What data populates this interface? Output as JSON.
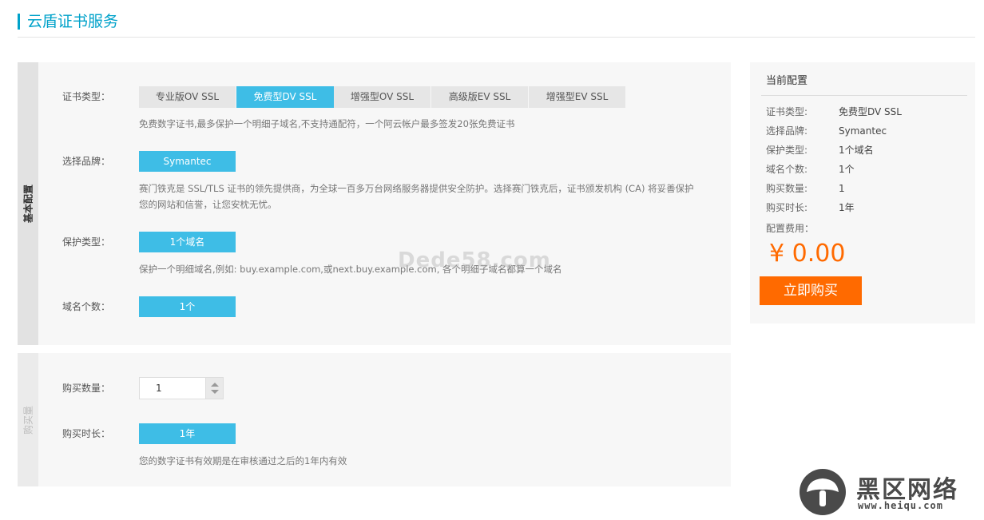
{
  "header": {
    "title": "云盾证书服务"
  },
  "basic": {
    "side_label": "基本配置",
    "cert_type": {
      "label": "证书类型：",
      "options": [
        "专业版OV SSL",
        "免费型DV SSL",
        "增强型OV SSL",
        "高级版EV SSL",
        "增强型EV SSL"
      ],
      "selected": "免费型DV SSL",
      "hint": "免费数字证书,最多保护一个明细子域名,不支持通配符，一个阿云帐户最多签发20张免费证书"
    },
    "brand": {
      "label": "选择品牌：",
      "value": "Symantec",
      "hint_line1": "赛门铁克是 SSL/TLS 证书的领先提供商，为全球一百多万台网络服务器提供安全防护。选择赛门铁克后，证书颁发机构 (CA) 将妥善保护",
      "hint_line2": "您的网站和信誉，让您安枕无忧。"
    },
    "protect": {
      "label": "保护类型：",
      "value": "1个域名",
      "hint": "保护一个明细域名,例如: buy.example.com,或next.buy.example.com, 各个明细子域名都算一个域名"
    },
    "domains": {
      "label": "域名个数：",
      "value": "1个"
    }
  },
  "buy": {
    "side_label": "购买量",
    "quantity": {
      "label": "购买数量：",
      "value": "1"
    },
    "duration": {
      "label": "购买时长：",
      "value": "1年",
      "hint": "您的数字证书有效期是在审核通过之后的1年内有效"
    }
  },
  "summary": {
    "title": "当前配置",
    "items": [
      {
        "k": "证书类型:",
        "v": "免费型DV SSL"
      },
      {
        "k": "选择品牌:",
        "v": "Symantec"
      },
      {
        "k": "保护类型:",
        "v": "1个域名"
      },
      {
        "k": "域名个数:",
        "v": "1个"
      },
      {
        "k": "购买数量:",
        "v": "1"
      },
      {
        "k": "购买时长:",
        "v": "1年"
      }
    ],
    "fee_label": "配置费用：",
    "price": "¥ 0.00",
    "buy_button": "立即购买"
  },
  "watermark": "Dede58.com",
  "logo": {
    "name": "黑区网络",
    "url": "www.heiqu.com"
  },
  "colors": {
    "accent": "#00a2ca",
    "selected": "#3ebde6",
    "orange": "#ff6a00"
  }
}
